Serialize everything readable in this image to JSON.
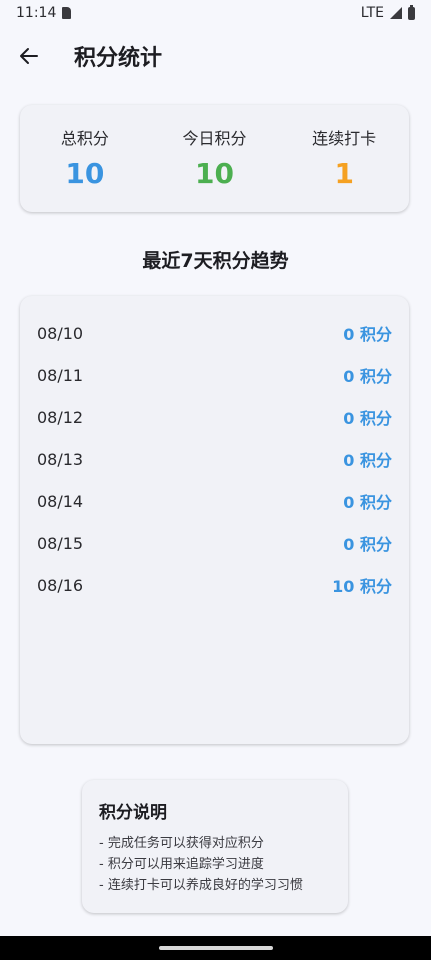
{
  "status_bar": {
    "time": "11:14",
    "network": "LTE"
  },
  "header": {
    "title": "积分统计",
    "back_icon": "arrow-left-icon"
  },
  "summary": [
    {
      "label": "总积分",
      "value": "10",
      "color": "#3a94e0"
    },
    {
      "label": "今日积分",
      "value": "10",
      "color": "#4caf50"
    },
    {
      "label": "连续打卡",
      "value": "1",
      "color": "#f5a122"
    }
  ],
  "trend": {
    "title": "最近7天积分趋势",
    "accent": "#3a94e0",
    "rows": [
      {
        "date": "08/10",
        "points": "0 积分"
      },
      {
        "date": "08/11",
        "points": "0 积分"
      },
      {
        "date": "08/12",
        "points": "0 积分"
      },
      {
        "date": "08/13",
        "points": "0 积分"
      },
      {
        "date": "08/14",
        "points": "0 积分"
      },
      {
        "date": "08/15",
        "points": "0 积分"
      },
      {
        "date": "08/16",
        "points": "10 积分"
      }
    ]
  },
  "info": {
    "title": "积分说明",
    "lines": [
      "- 完成任务可以获得对应积分",
      "- 积分可以用来追踪学习进度",
      "- 连续打卡可以养成良好的学习习惯"
    ]
  }
}
